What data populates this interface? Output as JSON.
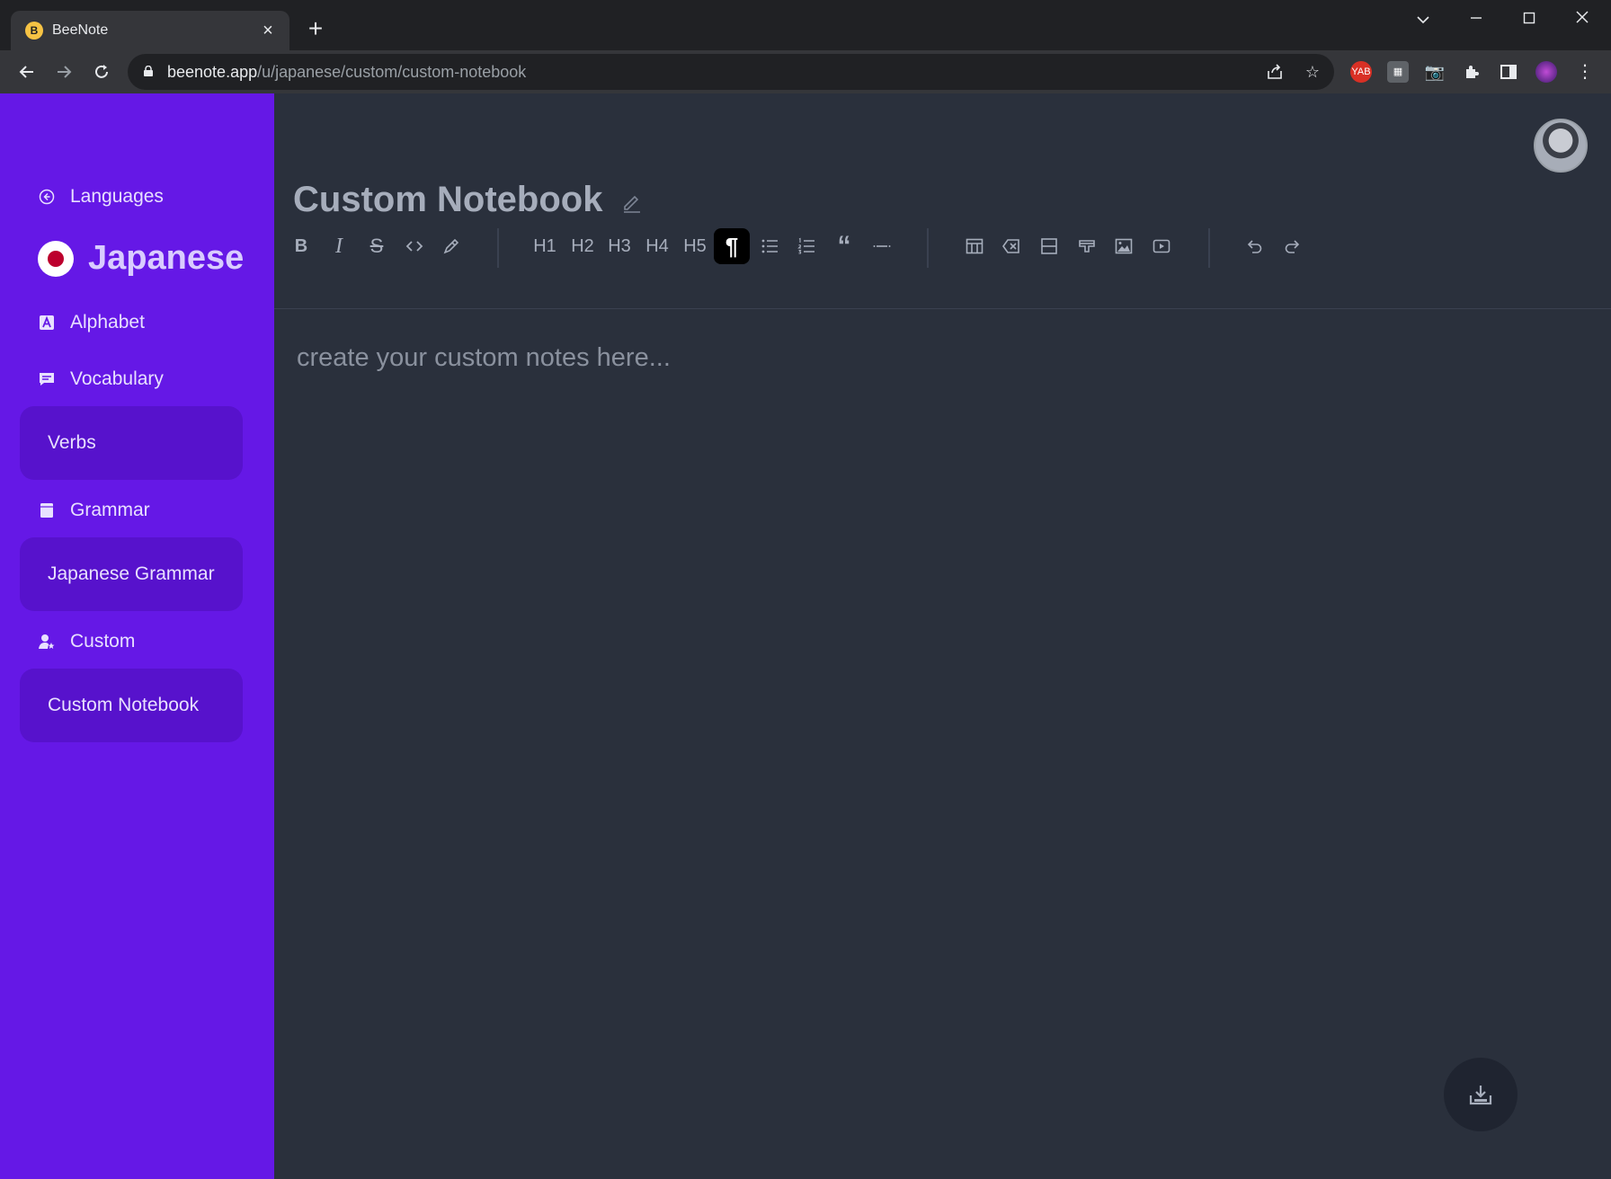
{
  "browser": {
    "tab_title": "BeeNote",
    "tab_favicon": "B",
    "url_host": "beenote.app",
    "url_path": "/u/japanese/custom/custom-notebook",
    "ext_yab": "YAB"
  },
  "sidebar": {
    "back_label": "Languages",
    "language": "Japanese",
    "sections": [
      {
        "label": "Alphabet",
        "icon": "alphabet-icon"
      },
      {
        "label": "Vocabulary",
        "icon": "chat-icon"
      },
      {
        "label": "Grammar",
        "icon": "book-icon"
      },
      {
        "label": "Custom",
        "icon": "user-star-icon"
      }
    ],
    "cards": [
      "Verbs",
      "Japanese Grammar",
      "Custom Notebook"
    ]
  },
  "main": {
    "title": "Custom Notebook",
    "editor_placeholder": "create your custom notes here...",
    "toolbar": {
      "headings": [
        "H1",
        "H2",
        "H3",
        "H4",
        "H5"
      ],
      "active": "paragraph"
    }
  },
  "colors": {
    "sidebar": "#6518e6",
    "card": "#5712cc",
    "main_bg": "#2a303c"
  }
}
